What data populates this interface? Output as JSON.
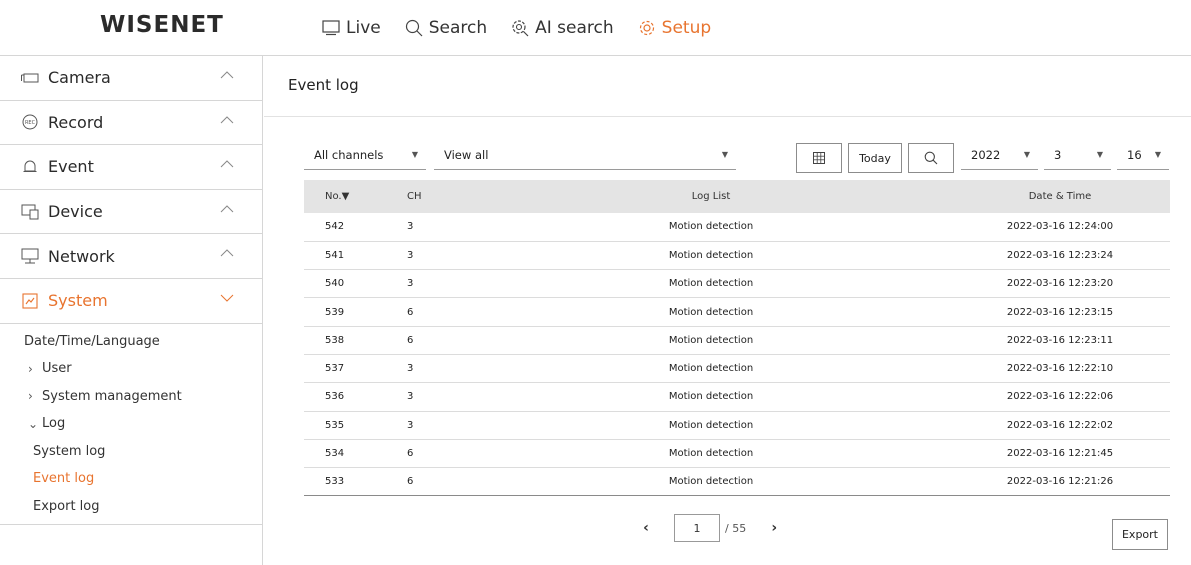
{
  "header": {
    "logo": "WISENET",
    "nav": [
      {
        "label": "Live",
        "icon": "monitor-icon",
        "active": false
      },
      {
        "label": "Search",
        "icon": "search-icon",
        "active": false
      },
      {
        "label": "AI search",
        "icon": "ai-search-icon",
        "active": false
      },
      {
        "label": "Setup",
        "icon": "gear-icon",
        "active": true
      }
    ]
  },
  "sidebar": {
    "items": [
      {
        "label": "Camera",
        "icon": "camera-icon"
      },
      {
        "label": "Record",
        "icon": "rec-icon",
        "icon_text": "REC"
      },
      {
        "label": "Event",
        "icon": "bell-icon"
      },
      {
        "label": "Device",
        "icon": "device-icon"
      },
      {
        "label": "Network",
        "icon": "network-icon"
      },
      {
        "label": "System",
        "icon": "system-icon",
        "active": true
      }
    ],
    "submenu": {
      "date_time_language": "Date/Time/Language",
      "user": "User",
      "system_management": "System management",
      "log": "Log",
      "system_log": "System log",
      "event_log": "Event log",
      "export_log": "Export log"
    }
  },
  "main": {
    "title": "Event log",
    "filters": {
      "channel": "All channels",
      "view": "View all",
      "year": "2022",
      "month": "3",
      "day": "16"
    },
    "buttons": {
      "today": "Today",
      "export": "Export"
    },
    "table": {
      "columns": [
        "No.▼",
        "CH",
        "Log List",
        "Date & Time"
      ],
      "rows": [
        {
          "no": "542",
          "ch": "3",
          "log": "Motion detection",
          "datetime": "2022-03-16 12:24:00"
        },
        {
          "no": "541",
          "ch": "3",
          "log": "Motion detection",
          "datetime": "2022-03-16 12:23:24"
        },
        {
          "no": "540",
          "ch": "3",
          "log": "Motion detection",
          "datetime": "2022-03-16 12:23:20"
        },
        {
          "no": "539",
          "ch": "6",
          "log": "Motion detection",
          "datetime": "2022-03-16 12:23:15"
        },
        {
          "no": "538",
          "ch": "6",
          "log": "Motion detection",
          "datetime": "2022-03-16 12:23:11"
        },
        {
          "no": "537",
          "ch": "3",
          "log": "Motion detection",
          "datetime": "2022-03-16 12:22:10"
        },
        {
          "no": "536",
          "ch": "3",
          "log": "Motion detection",
          "datetime": "2022-03-16 12:22:06"
        },
        {
          "no": "535",
          "ch": "3",
          "log": "Motion detection",
          "datetime": "2022-03-16 12:22:02"
        },
        {
          "no": "534",
          "ch": "6",
          "log": "Motion detection",
          "datetime": "2022-03-16 12:21:45"
        },
        {
          "no": "533",
          "ch": "6",
          "log": "Motion detection",
          "datetime": "2022-03-16 12:21:26"
        }
      ]
    },
    "pagination": {
      "current": "1",
      "total": "/ 55"
    }
  },
  "colors": {
    "accent": "#e8742f",
    "header_row": "#e4e4e4",
    "border": "#d6d6d6"
  }
}
